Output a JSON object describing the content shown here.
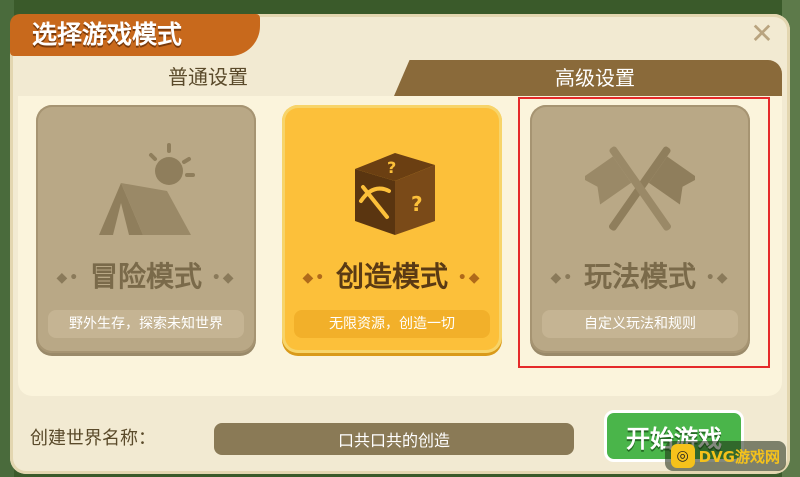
{
  "dialog": {
    "title": "选择游戏模式",
    "close_glyph": "✕"
  },
  "tabs": [
    {
      "label": "普通设置",
      "active": true
    },
    {
      "label": "高级设置",
      "active": false
    }
  ],
  "modes": [
    {
      "name": "冒险模式",
      "description": "野外生存，探索未知世界",
      "icon": "tent-icon",
      "selected": false
    },
    {
      "name": "创造模式",
      "description": "无限资源，创造一切",
      "icon": "mystery-box-icon",
      "selected": true
    },
    {
      "name": "玩法模式",
      "description": "自定义玩法和规则",
      "icon": "crossed-flags-icon",
      "selected": false
    }
  ],
  "world": {
    "label": "创建世界名称：",
    "value": "口共口共的创造"
  },
  "start_button": "开始游戏",
  "watermark": {
    "logo": "◎",
    "text": "DVG游戏网"
  },
  "colors": {
    "accent": "#c8691c",
    "selected_card": "#fcc03a",
    "start_button": "#4ab54a",
    "highlight": "#e52a2a"
  }
}
